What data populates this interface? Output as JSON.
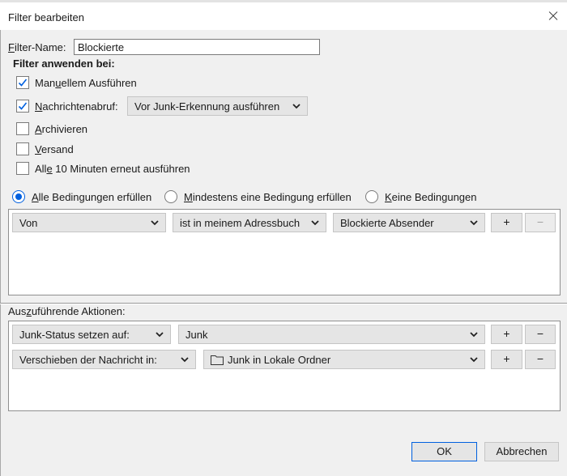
{
  "window": {
    "title": "Filter bearbeiten"
  },
  "filter_name": {
    "label_prefix": "F",
    "label_rest": "ilter-Name:",
    "value": "Blockierte"
  },
  "apply": {
    "heading": "Filter anwenden bei:",
    "manual": {
      "pre": "Man",
      "u": "u",
      "post": "ellem Ausführen",
      "checked": true
    },
    "fetch": {
      "pre": "",
      "u": "N",
      "post": "achrichtenabruf:",
      "checked": true,
      "option": "Vor Junk-Erkennung ausführen"
    },
    "archive": {
      "pre": "",
      "u": "A",
      "post": "rchivieren",
      "checked": false
    },
    "send": {
      "pre": "",
      "u": "V",
      "post": "ersand",
      "checked": false
    },
    "periodic": {
      "pre": "All",
      "u": "e",
      "post": " 10 Minuten erneut ausführen",
      "checked": false
    }
  },
  "match": {
    "all": {
      "u": "A",
      "rest": "lle Bedingungen erfüllen",
      "selected": true
    },
    "any": {
      "u": "M",
      "rest": "indestens eine Bedingung erfüllen",
      "selected": false
    },
    "none": {
      "u": "K",
      "rest": "eine Bedingungen",
      "selected": false
    }
  },
  "conditions": [
    {
      "field": "Von",
      "operator": "ist in meinem Adressbuch",
      "value": "Blockierte Absender",
      "add": "+",
      "remove": "−"
    }
  ],
  "actions": {
    "heading_pre": "Aus",
    "heading_u": "z",
    "heading_post": "uführende Aktionen:",
    "rows": [
      {
        "action": "Junk-Status setzen auf:",
        "target": "Junk",
        "add": "+",
        "remove": "−"
      },
      {
        "action": "Verschieben der Nachricht in:",
        "target": "Junk in Lokale Ordner",
        "add": "+",
        "remove": "−",
        "target_icon": "folder-icon"
      }
    ]
  },
  "buttons": {
    "ok": "OK",
    "cancel": "Abbrechen"
  },
  "colors": {
    "accent": "#0060df",
    "control_bg": "#e5e5e5",
    "window_bg": "#f0f0f0"
  }
}
